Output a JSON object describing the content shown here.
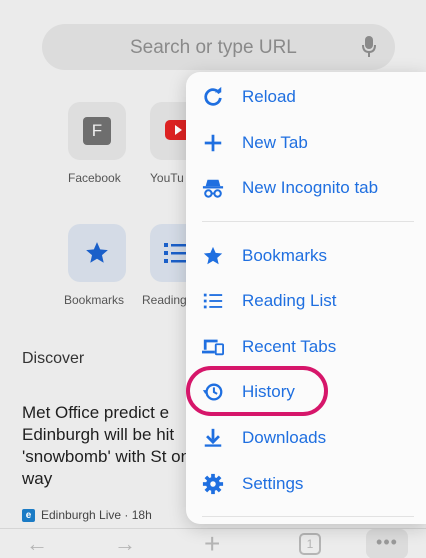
{
  "search": {
    "placeholder": "Search or type URL"
  },
  "shortcuts": [
    {
      "label": "Facebook",
      "letter": "F"
    },
    {
      "label": "YouTu"
    },
    {
      "label": "Bookmarks"
    },
    {
      "label": "Reading"
    }
  ],
  "discover": {
    "heading": "Discover"
  },
  "article": {
    "text": "Met Office predict e Edinburgh will be hit 'snowbomb' with St on way",
    "source": "Edinburgh Live · 18h",
    "source_icon": "e"
  },
  "toolbar": {
    "back": "←",
    "forward": "→",
    "new_tab": "+",
    "tab_count": "1",
    "more": "•••"
  },
  "menu": {
    "items": [
      {
        "label": "Reload",
        "icon": "reload-icon"
      },
      {
        "label": "New Tab",
        "icon": "plus-icon"
      },
      {
        "label": "New Incognito tab",
        "icon": "incognito-icon"
      },
      {
        "label": "Bookmarks",
        "icon": "star-icon"
      },
      {
        "label": "Reading List",
        "icon": "list-icon"
      },
      {
        "label": "Recent Tabs",
        "icon": "devices-icon"
      },
      {
        "label": "History",
        "icon": "history-icon"
      },
      {
        "label": "Downloads",
        "icon": "download-icon"
      },
      {
        "label": "Settings",
        "icon": "gear-icon"
      }
    ],
    "highlighted_item": "History"
  },
  "colors": {
    "accent": "#1f6fe0",
    "highlight": "#d6166a",
    "menu_bg": "#fbfbfb",
    "page_bg": "#ebebeb"
  }
}
